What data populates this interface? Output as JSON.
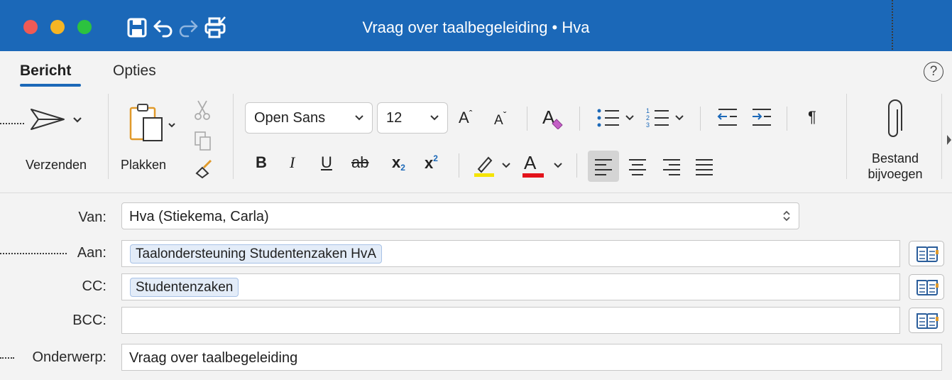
{
  "window": {
    "title": "Vraag over taalbegeleiding • Hva",
    "icons": [
      "save-icon",
      "undo-icon",
      "redo-icon",
      "print-icon"
    ]
  },
  "tabs": [
    {
      "label": "Bericht",
      "active": true
    },
    {
      "label": "Opties",
      "active": false
    }
  ],
  "help_label": "?",
  "ribbon": {
    "send_label": "Verzenden",
    "paste_label": "Plakken",
    "font_name": "Open Sans",
    "font_size": "12",
    "format": {
      "bold": "B",
      "italic": "I",
      "underline": "U",
      "strike": "ab",
      "subscript": "x",
      "subscript_mark": "2",
      "superscript": "x",
      "superscript_mark": "2",
      "font_color_letter": "A",
      "grow": "A",
      "shrink": "A",
      "clear_letter": "A",
      "paragraph_mark": "¶"
    },
    "attach_label_line1": "Bestand",
    "attach_label_line2": "bijvoegen"
  },
  "colors": {
    "titlebar": "#1b68b8",
    "highlight": "#f5e400",
    "font_color": "#e3131b",
    "chip_bg": "#e3ecf8"
  },
  "form": {
    "from_label": "Van:",
    "from_value": "Hva (Stiekema, Carla)",
    "to_label": "Aan:",
    "to_recipients": [
      "Taalondersteuning Studentenzaken HvA"
    ],
    "cc_label": "CC:",
    "cc_recipients": [
      "Studentenzaken"
    ],
    "bcc_label": "BCC:",
    "subject_label": "Onderwerp:",
    "subject_value": "Vraag over taalbegeleiding"
  }
}
